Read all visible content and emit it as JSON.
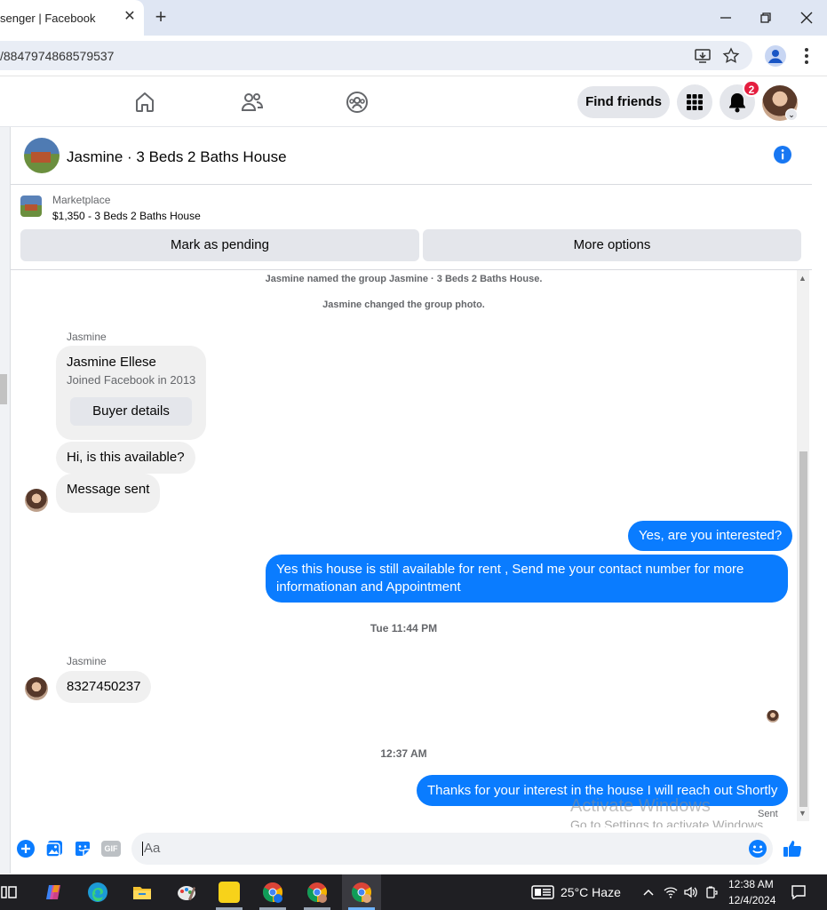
{
  "browser": {
    "tab_title": "senger | Facebook",
    "url": "/8847974868579537"
  },
  "fb_nav": {
    "find_friends": "Find friends",
    "notification_count": "2"
  },
  "chat": {
    "title": "Jasmine · 3 Beds 2 Baths House",
    "listing": {
      "label": "Marketplace",
      "price_title": "$1,350 - 3 Beds 2 Baths House"
    },
    "actions": {
      "mark_pending": "Mark as pending",
      "more_options": "More options"
    },
    "system_messages": [
      "Jasmine named the group Jasmine · 3 Beds 2 Baths House.",
      "Jasmine changed the group photo."
    ],
    "buyer_card": {
      "sender": "Jasmine",
      "name": "Jasmine Ellese",
      "joined": "Joined Facebook in 2013",
      "button": "Buyer details"
    },
    "incoming_1": "Hi, is this available?",
    "incoming_2": "Message sent",
    "outgoing_1": "Yes, are you interested?",
    "outgoing_2_line1": "Yes this house is still available for rent , Send me your contact number for more",
    "outgoing_2_line2": "informationan and Appointment",
    "timestamp_1": "Tue 11:44 PM",
    "sender_2": "Jasmine",
    "incoming_3": "8327450237",
    "timestamp_2": "12:37 AM",
    "outgoing_3": "Thanks for your interest in the house I will reach out Shortly",
    "sent_status": "Sent"
  },
  "composer": {
    "placeholder": "Aa",
    "gif_label": "GIF"
  },
  "watermark": {
    "line1": "Activate Windows",
    "line2": "Go to Settings to activate Windows."
  },
  "taskbar": {
    "weather": "25°C  Haze",
    "time": "12:38 AM",
    "date": "12/4/2024"
  },
  "colors": {
    "messenger_blue": "#0a7cff",
    "fb_blue": "#1877f2",
    "badge_red": "#e41e3f"
  }
}
